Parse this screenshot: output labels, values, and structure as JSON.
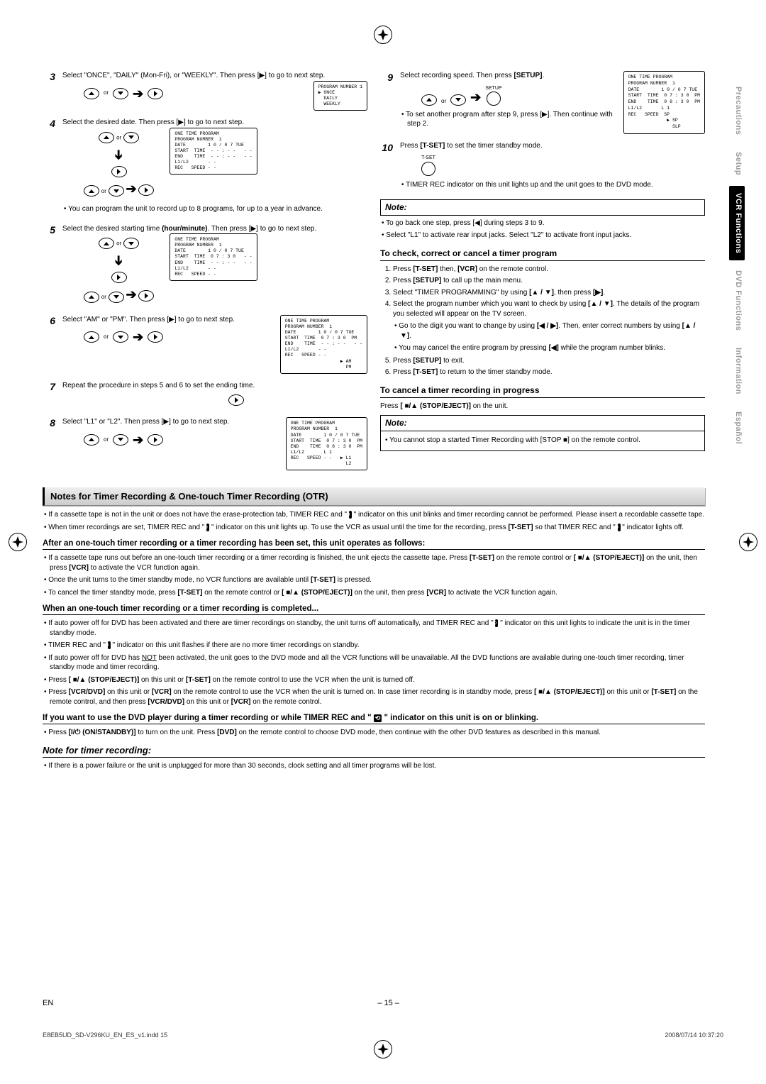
{
  "tabs": [
    "Precautions",
    "Setup",
    "VCR Functions",
    "DVD Functions",
    "Information",
    "Español"
  ],
  "activeTab": 2,
  "leftSteps": {
    "s3": {
      "text": "Select \"ONCE\", \"DAILY\" (Mon-Fri), or \"WEEKLY\". Then press [▶] to go to next step.",
      "osd": "PROGRAM NUMBER 1\n▶ ONCE\n  DAILY\n  WEEKLY"
    },
    "s4": {
      "text": "Select the desired date. Then press [▶] to go to next step.",
      "bullet": "You can program the unit to record up to 8 programs, for up to a year in advance.",
      "osd": "ONE TIME PROGRAM\nPROGRAM NUMBER  1\nDATE        1 0 / 0 7 TUE\nSTART  TIME  - - : - -   - -\nEND    TIME  - - : - -   - -\nL1/L2       - -\nREC   SPEED - -"
    },
    "s5": {
      "text_a": "Select the desired starting time ",
      "text_b": "(hour/minute)",
      "text_c": ". Then press [▶] to go to next step.",
      "osd": "ONE TIME PROGRAM\nPROGRAM NUMBER  1\nDATE        1 0 / 0 7 TUE\nSTART  TIME  0 7 : 3 0   - -\nEND    TIME  - - : - -   - -\nL1/L2       - -\nREC   SPEED - -"
    },
    "s6": {
      "text": "Select \"AM\" or \"PM\". Then press [▶] to go to next step.",
      "osd": "ONE TIME PROGRAM\nPROGRAM NUMBER  1\nDATE        1 0 / 0 7 TUE\nSTART  TIME  0 7 : 3 0  PM\nEND    TIME  - - : - -   - -\nL1/L2       - -\nREC   SPEED - -\n                    ▶ AM\n                      PM"
    },
    "s7": {
      "text": "Repeat the procedure in steps 5 and 6 to set the ending time."
    },
    "s8": {
      "text": "Select \"L1\" or \"L2\". Then press [▶] to go to next step.",
      "osd": "ONE TIME PROGRAM\nPROGRAM NUMBER  1\nDATE        1 0 / 0 7 TUE\nSTART  TIME  0 7 : 3 0  PM\nEND    TIME  0 8 : 3 0  PM\nL1/L2       L 1\nREC   SPEED - -   ▶ L1\n                    L2"
    }
  },
  "rightSteps": {
    "s9": {
      "text_a": "Select recording speed. Then press ",
      "text_b": "[SETUP]",
      "text_c": ".",
      "label": "SETUP",
      "bullet": "To set another program after step 9, press [▶]. Then continue with step 2.",
      "osd": "ONE TIME PROGRAM\nPROGRAM NUMBER  1\nDATE        1 0 / 0 7 TUE\nSTART  TIME  0 7 : 3 0  PM\nEND    TIME  0 8 : 3 0  PM\nL1/L2       L 1\nREC   SPEED  SP\n              ▶ SP\n                SLP"
    },
    "s10": {
      "text_a": "Press ",
      "text_b": "[T-SET]",
      "text_c": " to set the timer standby mode.",
      "label": "T-SET",
      "bullet": "TIMER REC indicator on this unit lights up and the unit goes to the DVD mode."
    },
    "noteHeader": "Note:",
    "noteBullets": [
      "To go back one step, press [◀] during steps 3 to 9.",
      "Select \"L1\" to activate rear input jacks. Select \"L2\" to activate front input jacks."
    ],
    "checkHeader": "To check, correct or cancel a timer program",
    "checkList": {
      "i1_a": "Press ",
      "i1_b": "[T-SET]",
      "i1_c": " then, ",
      "i1_d": "[VCR]",
      "i1_e": " on the remote control.",
      "i2_a": "Press ",
      "i2_b": "[SETUP]",
      "i2_c": " to call up the main menu.",
      "i3_a": "Select \"TIMER PROGRAMMING\" by using ",
      "i3_b": "[▲ / ▼]",
      "i3_c": ", then press ",
      "i3_d": "[▶]",
      "i3_e": ".",
      "i4_a": "Select the program number which you want to check by using ",
      "i4_b": "[▲ / ▼]",
      "i4_c": ". The details of the program you selected will appear on the TV screen.",
      "i4_sub1_a": "Go to the digit you want to change by using ",
      "i4_sub1_b": "[◀ / ▶]",
      "i4_sub1_c": ". Then, enter correct numbers by using ",
      "i4_sub1_d": "[▲ / ▼]",
      "i4_sub1_e": ".",
      "i4_sub2_a": "You may cancel the entire program by pressing ",
      "i4_sub2_b": "[◀]",
      "i4_sub2_c": " while the program number blinks.",
      "i5_a": "Press ",
      "i5_b": "[SETUP]",
      "i5_c": " to exit.",
      "i6_a": "Press ",
      "i6_b": "[T-SET]",
      "i6_c": " to return to the timer standby mode."
    },
    "cancelHeader": "To cancel a timer recording in progress",
    "cancelText_a": "Press ",
    "cancelText_b": "[ ■/▲ (STOP/EJECT)]",
    "cancelText_c": " on the unit.",
    "note2Header": "Note:",
    "note2Bullet": "You cannot stop a started Timer Recording with [STOP ■] on the remote control."
  },
  "bottom": {
    "bar1": "Notes for Timer Recording & One-touch Timer Recording (OTR)",
    "p1_a": "If a cassette tape is not in the unit or does not have the erase-protection tab, TIMER REC and \" ",
    "p1_b": " \" indicator on this unit blinks and timer recording cannot be performed. Please insert a recordable cassette tape.",
    "p2_a": "When timer recordings are set, TIMER REC and \" ",
    "p2_b": " \" indicator on this unit lights up. To use the VCR as usual until the time for the recording, press ",
    "p2_c": "[T-SET]",
    "p2_d": " so that TIMER REC and \" ",
    "p2_e": " \" indicator lights off.",
    "sub1": "After an one-touch timer recording or a timer recording has been set, this unit operates as follows:",
    "q1_a": "If a cassette tape runs out before an one-touch timer recording or a timer recording is finished, the unit ejects the cassette tape. Press ",
    "q1_b": "[T-SET]",
    "q1_c": " on the remote control or ",
    "q1_d": "[ ■/▲ (STOP/EJECT)]",
    "q1_e": " on the unit, then press ",
    "q1_f": "[VCR]",
    "q1_g": " to activate the VCR function again.",
    "q2_a": "Once the unit turns to the timer standby mode, no VCR functions are available until ",
    "q2_b": "[T-SET]",
    "q2_c": " is pressed.",
    "q3_a": "To cancel the timer standby mode, press ",
    "q3_b": "[T-SET]",
    "q3_c": " on the remote control or ",
    "q3_d": "[ ■/▲ (STOP/EJECT)]",
    "q3_e": " on the unit, then press ",
    "q3_f": "[VCR]",
    "q3_g": " to activate the VCR function again.",
    "sub2": "When an one-touch timer recording or a timer recording is completed...",
    "r1_a": "If auto power off for DVD has been activated and there are timer recordings on standby, the unit turns off automatically, and TIMER REC and \" ",
    "r1_b": " \" indicator on this unit lights to indicate the unit is in the timer standby mode.",
    "r2_a": "TIMER REC and \" ",
    "r2_b": " \" indicator on this unit flashes if there are no more timer recordings on standby.",
    "r3_a": "If auto power off for DVD has ",
    "r3_b": "NOT",
    "r3_c": " been activated, the unit goes to the DVD mode and all the VCR functions will be unavailable. All the DVD functions are available during one-touch timer recording, timer standby mode and timer recording.",
    "r4_a": "Press ",
    "r4_b": "[ ■/▲ (STOP/EJECT)]",
    "r4_c": " on this unit or ",
    "r4_d": "[T-SET]",
    "r4_e": " on the remote control to use the VCR when the unit is turned off.",
    "r5_a": "Press ",
    "r5_b": "[VCR/DVD]",
    "r5_c": " on this unit or ",
    "r5_d": "[VCR]",
    "r5_e": " on the remote control to use the VCR when the unit is turned on. In case timer recording is in standby mode, press ",
    "r5_f": "[ ■/▲ (STOP/EJECT)]",
    "r5_g": " on this unit or ",
    "r5_h": "[T-SET]",
    "r5_i": " on the remote control, and then press ",
    "r5_j": "[VCR/DVD]",
    "r5_k": " on this unit or ",
    "r5_l": "[VCR]",
    "r5_m": " on the remote control.",
    "sub3_a": "If you want to use the DVD player during a timer recording or while TIMER REC and \" ",
    "sub3_b": " \" indicator on this unit is on or blinking.",
    "t1_a": "Press ",
    "t1_b": "[I/⏻ (ON/STANDBY)]",
    "t1_c": " to turn on the unit. Press ",
    "t1_d": "[DVD]",
    "t1_e": " on the remote control to choose DVD mode, then continue with the other DVD features as described in this manual.",
    "noteHeader": "Note for timer recording:",
    "noteBullet": "If there is a power failure or the unit is unplugged for more than 30 seconds, clock setting and all timer programs will be lost."
  },
  "footer": {
    "left": "EN",
    "center": "– 15 –"
  },
  "printline": {
    "left": "E8EB5UD_SD-V296KU_EN_ES_v1.indd   15",
    "right": "2008/07/14   10:37:20"
  }
}
